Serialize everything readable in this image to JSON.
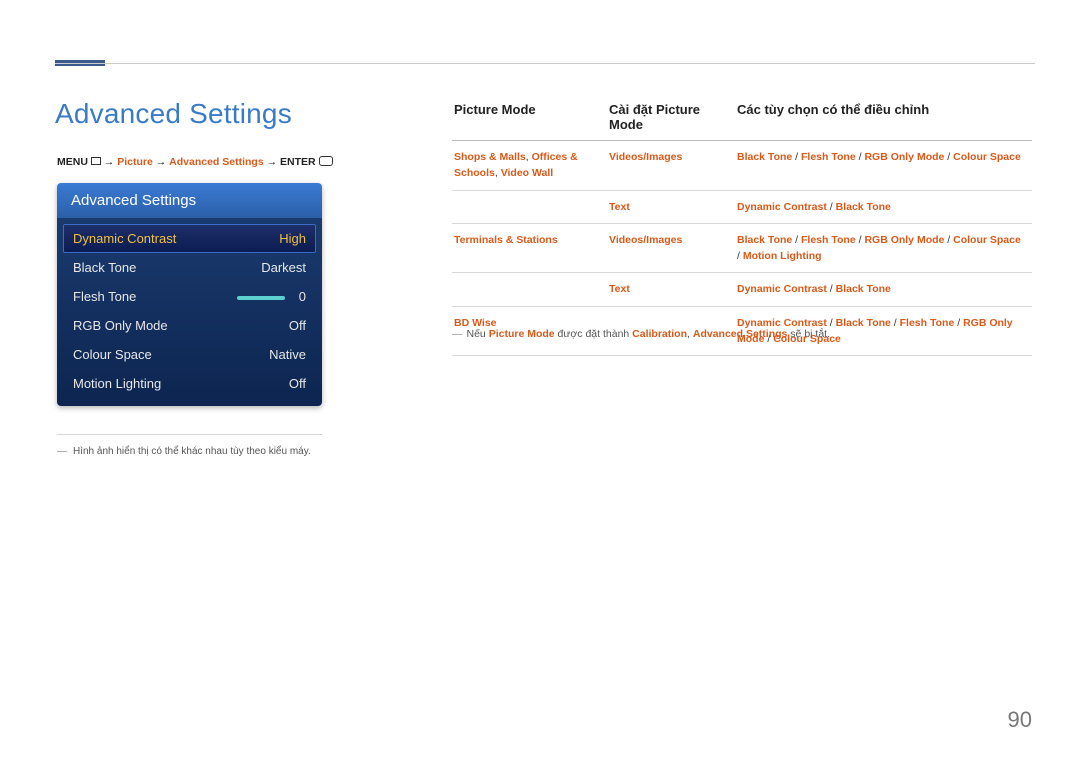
{
  "page": {
    "title": "Advanced Settings",
    "number": "90"
  },
  "breadcrumb": {
    "menu": "MENU",
    "arrow": " → ",
    "picture": "Picture",
    "advanced": "Advanced Settings",
    "enter": "ENTER"
  },
  "osd": {
    "header": "Advanced Settings",
    "rows": [
      {
        "label": "Dynamic Contrast",
        "value": "High",
        "selected": true,
        "slider": false
      },
      {
        "label": "Black Tone",
        "value": "Darkest",
        "selected": false,
        "slider": false
      },
      {
        "label": "Flesh Tone",
        "value": "0",
        "selected": false,
        "slider": true
      },
      {
        "label": "RGB Only Mode",
        "value": "Off",
        "selected": false,
        "slider": false
      },
      {
        "label": "Colour Space",
        "value": "Native",
        "selected": false,
        "slider": false
      },
      {
        "label": "Motion Lighting",
        "value": "Off",
        "selected": false,
        "slider": false
      }
    ],
    "note": "Hình ảnh hiển thị có thể khác nhau tùy theo kiểu máy."
  },
  "table": {
    "headers": {
      "c0": "Picture Mode",
      "c1": "Cài đặt Picture Mode",
      "c2": "Các tùy chọn có thể điều chỉnh"
    },
    "rows": [
      {
        "mode_parts": [
          "Shops & Malls",
          ", ",
          "Offices & Schools",
          ", ",
          "Video Wall"
        ],
        "sub_parts": [
          "Videos/Images"
        ],
        "opt_parts": [
          "Black Tone",
          " / ",
          "Flesh Tone",
          " / ",
          "RGB Only Mode",
          " / ",
          "Colour Space"
        ]
      },
      {
        "mode_parts": [],
        "sub_parts": [
          "Text"
        ],
        "opt_parts": [
          "Dynamic Contrast",
          " / ",
          "Black Tone"
        ]
      },
      {
        "mode_parts": [
          "Terminals & Stations"
        ],
        "sub_parts": [
          "Videos/Images"
        ],
        "opt_parts": [
          "Black Tone",
          " / ",
          "Flesh Tone",
          " / ",
          "RGB Only Mode",
          " / ",
          "Colour Space",
          " / ",
          "Motion Lighting"
        ]
      },
      {
        "mode_parts": [],
        "sub_parts": [
          "Text"
        ],
        "opt_parts": [
          "Dynamic Contrast",
          " / ",
          "Black Tone"
        ]
      },
      {
        "mode_parts": [
          "BD Wise"
        ],
        "sub_parts": [],
        "opt_parts": [
          "Dynamic Contrast",
          " / ",
          "Black Tone",
          " / ",
          "Flesh Tone",
          " / ",
          "RGB Only Mode",
          " / ",
          "Colour Space"
        ]
      }
    ]
  },
  "footnote": {
    "pre": "Nếu ",
    "pm": "Picture Mode",
    "mid": " được đặt thành ",
    "cal": "Calibration",
    "sep": ", ",
    "adv": "Advanced Settings",
    "post": " sẽ bị tắt."
  }
}
